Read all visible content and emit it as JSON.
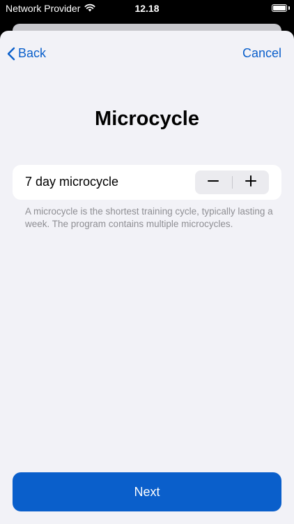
{
  "status_bar": {
    "carrier": "Network Provider",
    "time": "12.18",
    "wifi_icon": "wifi-icon",
    "battery_icon": "battery-icon"
  },
  "nav": {
    "back_label": "Back",
    "back_icon": "chevron-left-icon",
    "cancel_label": "Cancel"
  },
  "page": {
    "title": "Microcycle"
  },
  "microcycle": {
    "label": "7 day microcycle",
    "decrement_icon": "minus-icon",
    "increment_icon": "plus-icon"
  },
  "help": {
    "text": "A microcycle is the shortest training cycle, typically lasting a week. The program contains multiple microcycles."
  },
  "footer": {
    "next_label": "Next"
  },
  "colors": {
    "accent": "#0a5fcb",
    "sheet_background": "#f2f2f7",
    "secondary_text": "#8e8e93"
  }
}
